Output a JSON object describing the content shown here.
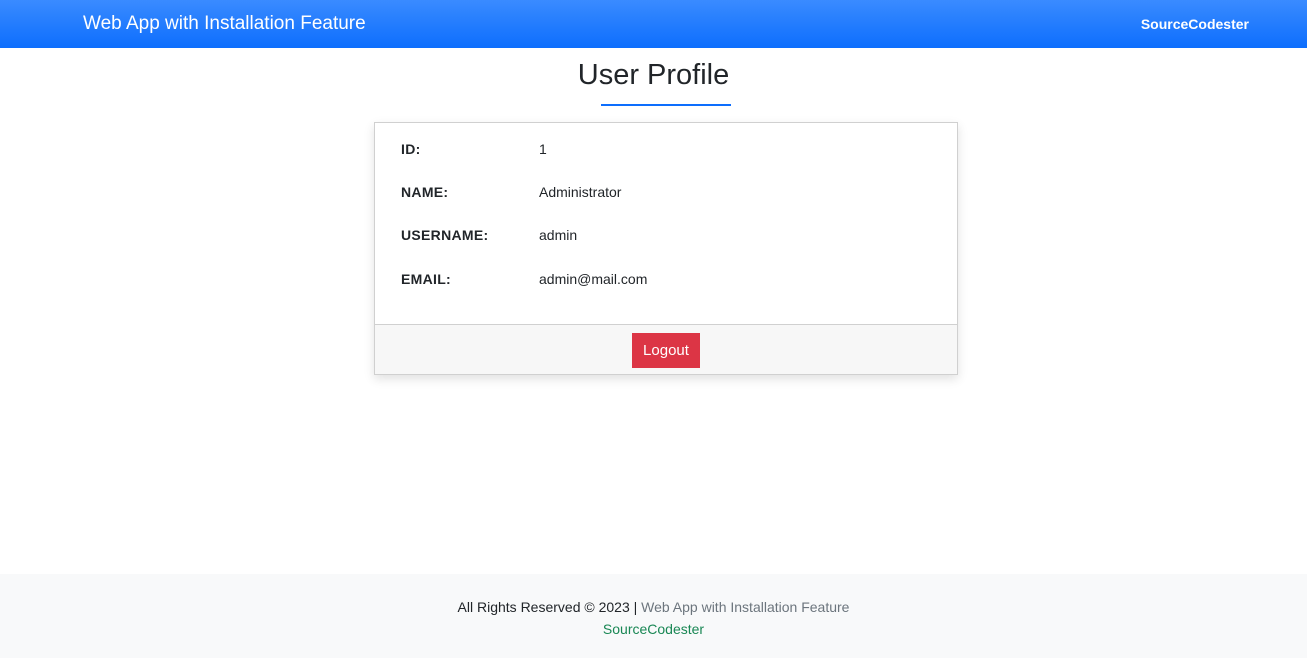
{
  "navbar": {
    "brand": "Web App with Installation Feature",
    "link": "SourceCodester"
  },
  "page": {
    "title": "User Profile"
  },
  "profile": {
    "rows": [
      {
        "label": "ID:",
        "value": "1"
      },
      {
        "label": "NAME:",
        "value": "Administrator"
      },
      {
        "label": "USERNAME:",
        "value": "admin"
      },
      {
        "label": "EMAIL:",
        "value": "admin@mail.com"
      }
    ],
    "logout_label": "Logout"
  },
  "footer": {
    "rights_text": "All Rights Reserved © 2023 |",
    "app_link": "Web App with Installation Feature",
    "source_link": "SourceCodester"
  },
  "colors": {
    "navbar": "#0d6efd",
    "logout": "#dc3545",
    "underline": "#0d6efd",
    "footer_link": "#198754"
  }
}
